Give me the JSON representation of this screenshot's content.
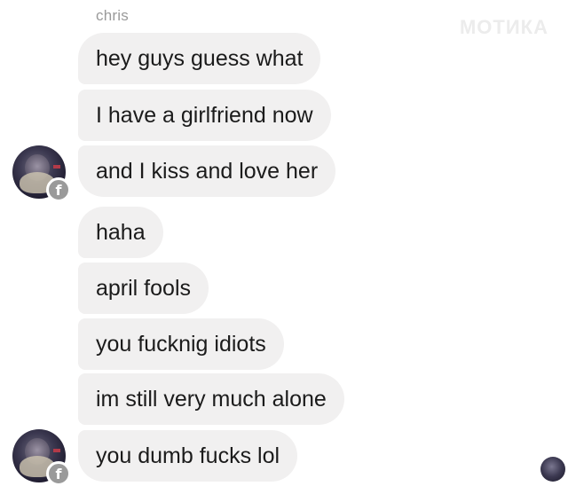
{
  "conversation": {
    "sender_name": "chris",
    "watermark": "МОТИКА",
    "messages": [
      {
        "text": "hey guys guess what"
      },
      {
        "text": "I have a girlfriend now"
      },
      {
        "text": "and I kiss and love her"
      },
      {
        "text": "haha"
      },
      {
        "text": "april fools"
      },
      {
        "text": "you fucknig idiots"
      },
      {
        "text": "im still very much alone"
      },
      {
        "text": "you dumb fucks lol"
      }
    ],
    "avatar_badge": "f"
  },
  "colors": {
    "bubble": "#f1f0f0",
    "text": "#1b1b1b",
    "sender_name": "#9a9a9a",
    "background": "#ffffff"
  },
  "icons": {
    "avatar": "profile-photo",
    "badge": "facebook-icon",
    "read_receipt": "seen-avatar-icon"
  }
}
